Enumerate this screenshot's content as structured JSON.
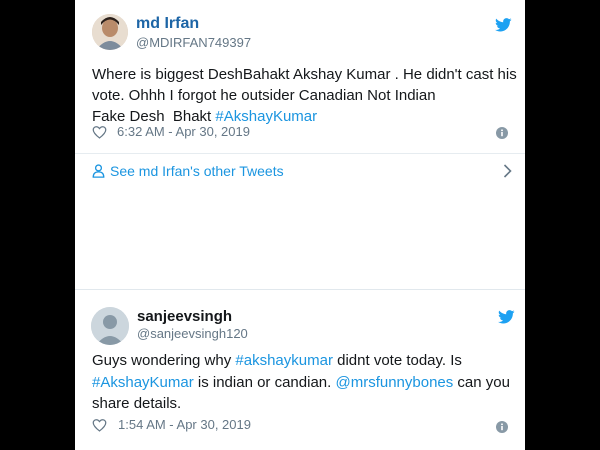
{
  "tweets": [
    {
      "name": "md Irfan",
      "handle": "@MDIRFAN749397",
      "lines": [
        [
          {
            "t": "Where is biggest DeshBahakt Akshay Kumar . He didn't cast his"
          }
        ],
        [
          {
            "t": "vote. Ohhh I forgot he outsider Canadian Not Indian"
          }
        ],
        [
          {
            "t": "Fake Desh  Bhakt "
          },
          {
            "t": "#AkshayKumar",
            "tag": true
          }
        ]
      ],
      "timestamp": "6:32 AM - Apr 30, 2019",
      "see_more": "See md Irfan's other Tweets"
    },
    {
      "name": "sanjeevsingh",
      "handle": "@sanjeevsingh120",
      "lines": [
        [
          {
            "t": "Guys wondering why "
          },
          {
            "t": "#akshaykumar",
            "tag": true
          },
          {
            "t": " didnt vote today. Is"
          }
        ],
        [
          {
            "t": "#AkshayKumar",
            "tag": true
          },
          {
            "t": " is indian or candian. "
          },
          {
            "t": "@mrsfunnybones",
            "tag": true
          },
          {
            "t": " can you"
          }
        ],
        [
          {
            "t": "share details."
          }
        ]
      ],
      "timestamp": "1:54 AM - Apr 30, 2019"
    }
  ],
  "colors": {
    "link": "#1b95e0",
    "name_link": "#1d65a6",
    "muted": "#657786",
    "text": "#14171a"
  }
}
